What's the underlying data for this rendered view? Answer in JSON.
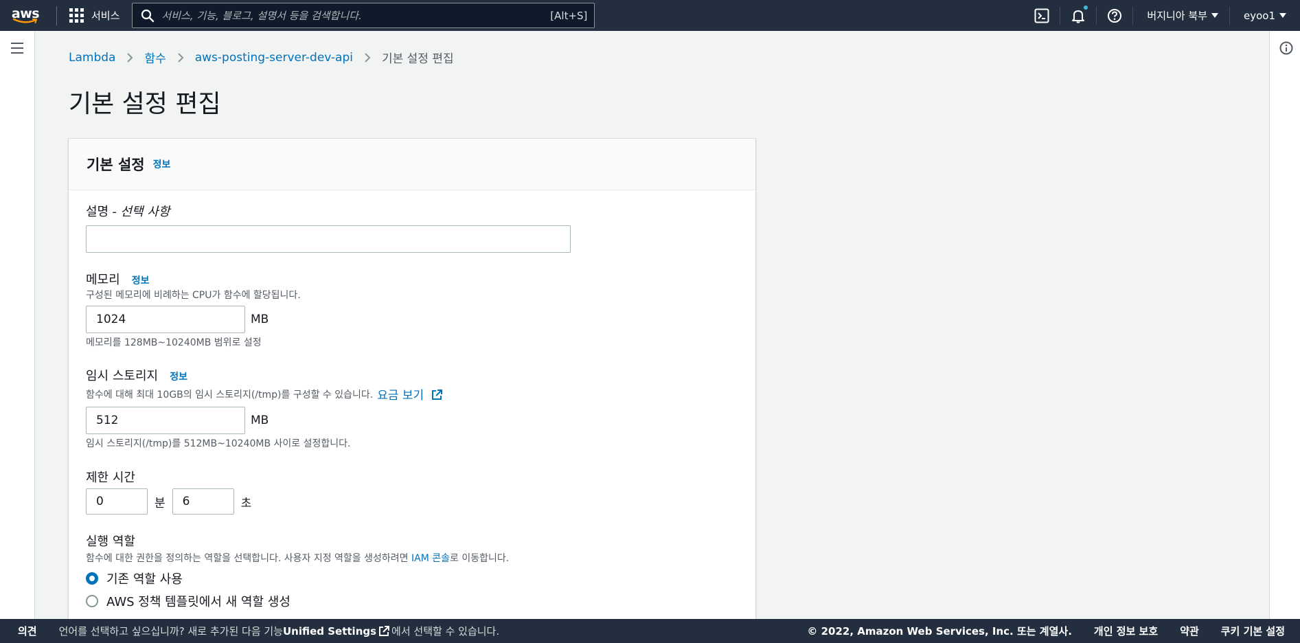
{
  "topnav": {
    "logo": "aws",
    "services_label": "서비스",
    "search_placeholder": "서비스, 기능, 블로그, 설명서 등을 검색합니다.",
    "search_shortcut": "[Alt+S]",
    "region_label": "버지니아 북부",
    "user_label": "eyoo1"
  },
  "breadcrumb": {
    "items": [
      "Lambda",
      "함수",
      "aws-posting-server-dev-api"
    ],
    "current": "기본 설정 편집"
  },
  "page_title": "기본 설정 편집",
  "panel": {
    "title": "기본 설정",
    "info_link": "정보"
  },
  "description_field": {
    "label": "설명",
    "label_optional": "- 선택 사항",
    "value": "",
    "placeholder": ""
  },
  "memory": {
    "label": "메모리",
    "info_link": "정보",
    "description": "구성된 메모리에 비례하는 CPU가 함수에 할당됩니다.",
    "value": "1024",
    "unit": "MB",
    "constraint": "메모리를 128MB~10240MB 범위로 설정"
  },
  "ephemeral_storage": {
    "label": "임시 스토리지",
    "info_link": "정보",
    "description": "함수에 대해 최대 10GB의 임시 스토리지(/tmp)를 구성할 수 있습니다.",
    "pricing_link": "요금 보기",
    "value": "512",
    "unit": "MB",
    "constraint": "임시 스토리지(/tmp)를 512MB~10240MB 사이로 설정합니다."
  },
  "timeout": {
    "label": "제한 시간",
    "minutes_value": "0",
    "minutes_unit": "분",
    "seconds_value": "6",
    "seconds_unit": "초"
  },
  "execution_role": {
    "label": "실행 역할",
    "description_pre": "함수에 대한 권한을 정의하는 역할을 선택합니다. 사용자 지정 역할을 생성하려면 ",
    "iam_link": "IAM 콘솔",
    "description_post": "로 이동합니다.",
    "options": [
      "기존 역할 사용",
      "AWS 정책 템플릿에서 새 역할 생성"
    ],
    "selected_index": 0
  },
  "footer": {
    "feedback": "의견",
    "message_pre": "언어를 선택하고 싶으십니까? 새로 추가된 다음 기능 ",
    "message_bold": "Unified Settings",
    "message_post": "에서 선택할 수 있습니다.",
    "copyright": "© 2022, Amazon Web Services, Inc. 또는 계열사.",
    "links": [
      "개인 정보 보호",
      "약관",
      "쿠키 기본 설정"
    ]
  },
  "colors": {
    "nav_bg": "#232f3e",
    "link": "#0073bb",
    "page_bg": "#f2f3f3",
    "aws_orange": "#ff9900"
  }
}
